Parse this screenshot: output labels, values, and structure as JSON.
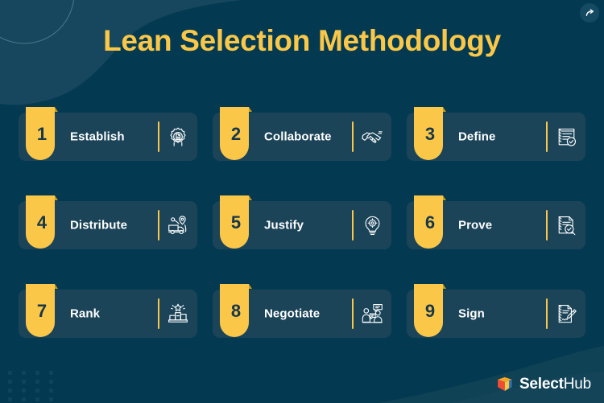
{
  "page": {
    "title": "Lean Selection Methodology",
    "background_color": "#033a51",
    "accent_color": "#fac748",
    "card_color": "#1b4459",
    "text_color": "#ffffff"
  },
  "header": {
    "share_button": {
      "label": "",
      "icon": "share-arrow-icon"
    }
  },
  "steps": [
    {
      "number": "1",
      "label": "Establish",
      "icon": "gear-document-icon"
    },
    {
      "number": "2",
      "label": "Collaborate",
      "icon": "handshake-icon"
    },
    {
      "number": "3",
      "label": "Define",
      "icon": "checklist-check-icon"
    },
    {
      "number": "4",
      "label": "Distribute",
      "icon": "delivery-truck-map-pin-icon"
    },
    {
      "number": "5",
      "label": "Justify",
      "icon": "lightbulb-target-icon"
    },
    {
      "number": "6",
      "label": "Prove",
      "icon": "document-magnifier-icon"
    },
    {
      "number": "7",
      "label": "Rank",
      "icon": "podium-star-icon"
    },
    {
      "number": "8",
      "label": "Negotiate",
      "icon": "people-discussion-icon"
    },
    {
      "number": "9",
      "label": "Sign",
      "icon": "document-pen-icon"
    }
  ],
  "footer": {
    "logo": {
      "mark": "selecthub-cube-icon",
      "name_bold": "Select",
      "name_light": "Hub"
    }
  }
}
